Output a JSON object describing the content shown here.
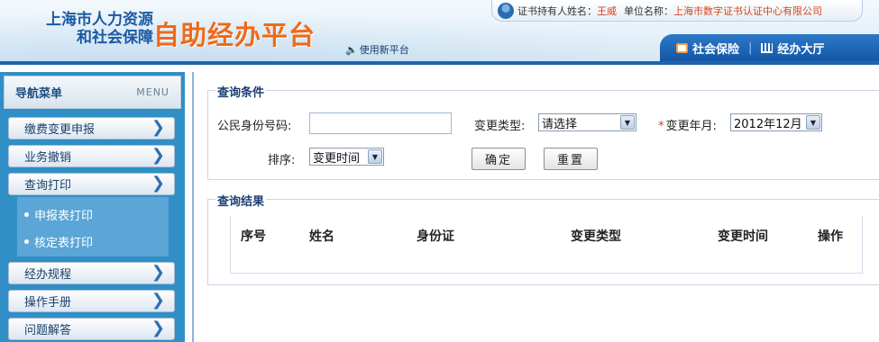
{
  "header": {
    "org_line1": "上海市人力资源",
    "org_line2": "和社会保障",
    "title": "自助经办平台",
    "new_platform_link": " 使用新平台",
    "holder_label": "证书持有人姓名：",
    "holder_name": "王威",
    "unit_label": "单位名称：",
    "unit_name": "上海市数字证书认证中心有限公司",
    "tabs": [
      {
        "label": "社会保险",
        "icon": "card-icon"
      },
      {
        "label": "经办大厅",
        "icon": "hall-icon"
      }
    ]
  },
  "sidebar": {
    "title": "导航菜单",
    "menu_label": "MENU",
    "items": [
      {
        "label": "缴费变更申报"
      },
      {
        "label": "业务撤销"
      },
      {
        "label": "查询打印"
      },
      {
        "label": "经办规程"
      },
      {
        "label": "操作手册"
      },
      {
        "label": "问题解答"
      }
    ],
    "sub_items": [
      {
        "label": "申报表打印"
      },
      {
        "label": "核定表打印"
      }
    ]
  },
  "query": {
    "legend": "查询条件",
    "id_label": "公民身份号码:",
    "id_value": "",
    "type_label": "变更类型:",
    "type_value": "请选择",
    "month_required": "*",
    "month_label": "变更年月:",
    "month_value": "2012年12月",
    "sort_label": "排序:",
    "sort_value": "变更时间",
    "confirm_label": "确定",
    "reset_label": "重置"
  },
  "results": {
    "legend": "查询结果",
    "columns": [
      "序号",
      "姓名",
      "身份证",
      "变更类型",
      "变更时间",
      "操作"
    ]
  }
}
